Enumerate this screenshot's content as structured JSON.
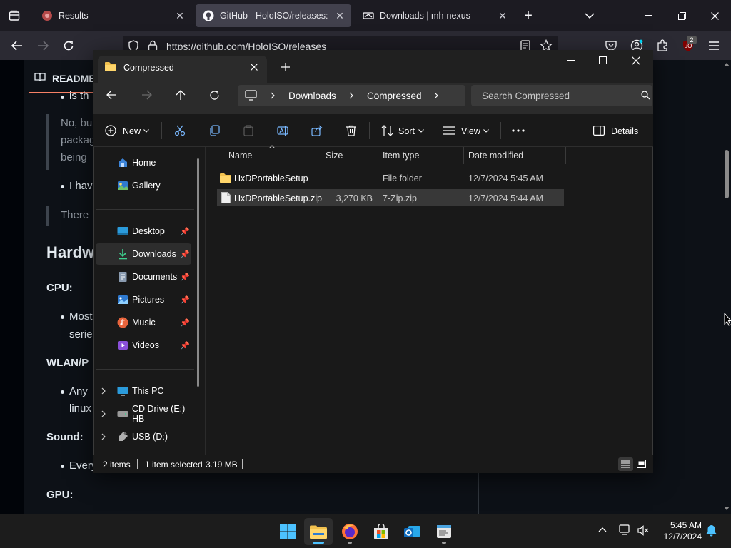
{
  "browser": {
    "tabs": [
      {
        "title": "Results"
      },
      {
        "title": "GitHub - HoloISO/releases: To u"
      },
      {
        "title": "Downloads | mh-nexus"
      }
    ],
    "url": "https://github.com/HoloISO/releases",
    "extension_badge": "2"
  },
  "github": {
    "tab_readme": "README",
    "lines": {
      "l1": "is th",
      "l2": "No, bu",
      "l3": "packag",
      "l4": "being",
      "l5": "I hav",
      "l6": "There",
      "h_hardware": "Hardw",
      "cpu": "CPU:",
      "cpu_b1": "Most",
      "cpu_b2": "serie",
      "wlan": "WLAN/P",
      "wlan_b1": "Any",
      "wlan_b2": "linux",
      "sound": "Sound:",
      "sound_b1": "Every",
      "gpu": "GPU:"
    }
  },
  "explorer": {
    "tab_title": "Compressed",
    "breadcrumb": [
      "Downloads",
      "Compressed"
    ],
    "search_placeholder": "Search Compressed",
    "toolbar": {
      "new_label": "New",
      "sort_label": "Sort",
      "view_label": "View",
      "details_label": "Details"
    },
    "nav": {
      "home": "Home",
      "gallery": "Gallery",
      "desktop": "Desktop",
      "downloads": "Downloads",
      "documents": "Documents",
      "pictures": "Pictures",
      "music": "Music",
      "videos": "Videos",
      "this_pc": "This PC",
      "cd_drive": "CD Drive (E:) HB",
      "usb": "USB (D:)"
    },
    "columns": {
      "name": "Name",
      "size": "Size",
      "type": "Item type",
      "date": "Date modified"
    },
    "files": [
      {
        "name": "HxDPortableSetup",
        "size": "",
        "type": "File folder",
        "date": "12/7/2024 5:45 AM"
      },
      {
        "name": "HxDPortableSetup.zip",
        "size": "3,270 KB",
        "type": "7-Zip.zip",
        "date": "12/7/2024 5:44 AM"
      }
    ],
    "status": {
      "count": "2 items",
      "selected": "1 item selected",
      "size": "3.19 MB"
    }
  },
  "taskbar": {
    "time": "5:45 AM",
    "date": "12/7/2024"
  }
}
